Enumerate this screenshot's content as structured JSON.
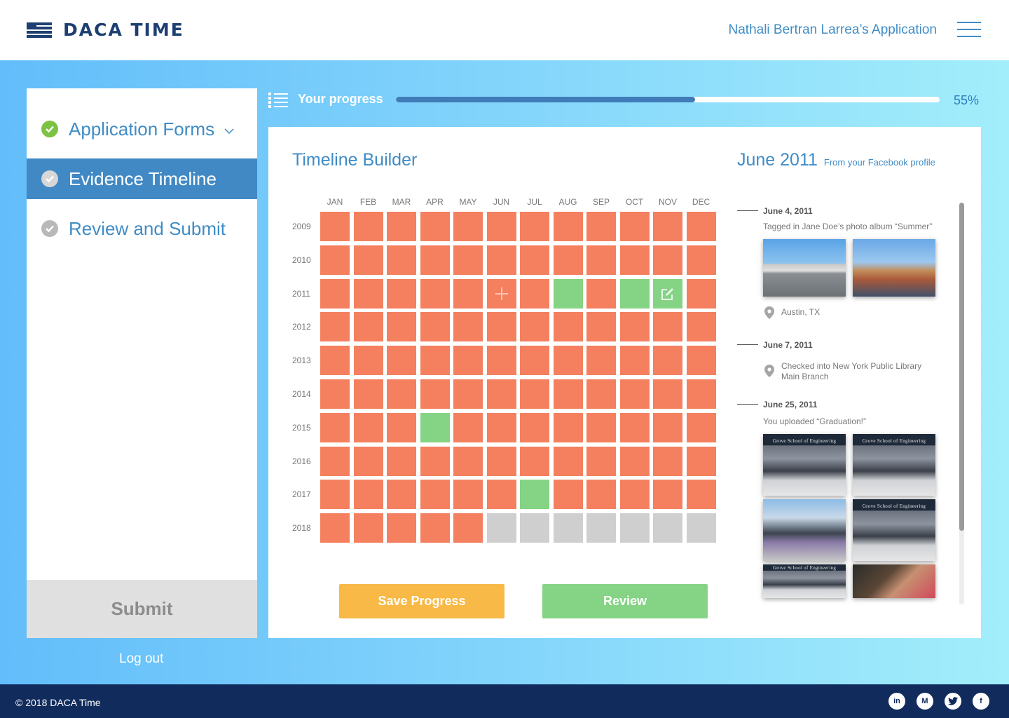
{
  "header": {
    "logo_text": "DACA TIME",
    "user_application": "Nathali Bertran Larrea’s Application"
  },
  "sidebar": {
    "items": [
      {
        "label": "Application Forms",
        "status": "complete",
        "active": false
      },
      {
        "label": "Evidence Timeline",
        "status": "pending",
        "active": true
      },
      {
        "label": "Review and Submit",
        "status": "pending",
        "active": false
      }
    ],
    "submit_label": "Submit",
    "logout_label": "Log out"
  },
  "progress": {
    "label": "Your progress",
    "value": 0.55,
    "value_text": "55%"
  },
  "timeline": {
    "title": "Timeline Builder",
    "months": [
      "JAN",
      "FEB",
      "MAR",
      "APR",
      "MAY",
      "JUN",
      "JUL",
      "AUG",
      "SEP",
      "OCT",
      "NOV",
      "DEC"
    ],
    "years": [
      "2009",
      "2010",
      "2011",
      "2012",
      "2013",
      "2014",
      "2015",
      "2016",
      "2017",
      "2018"
    ],
    "status_legend": {
      "m": "missing",
      "g": "complete",
      "x": "future"
    },
    "cells": [
      "mmmmmmmmmmmm",
      "mmmmmmmmmmmm",
      "mmmmmmmgmggm",
      "mmmmmmmmmmmm",
      "mmmmmmmmmmmm",
      "mmmmmmmmmmmm",
      "mmmgmmmmmmmm",
      "mmmmmmmmmmmm",
      "mmmmmmgmmmmm",
      "mmmmmxxxxxxx"
    ],
    "cell_icons": [
      {
        "year": "2011",
        "month": "JUN",
        "icon": "plus-icon"
      },
      {
        "year": "2011",
        "month": "NOV",
        "icon": "edit-icon"
      }
    ],
    "colors": {
      "missing": "#f4805f",
      "complete": "#85d384",
      "future": "#cfcfcf"
    }
  },
  "buttons": {
    "save": "Save Progress",
    "review": "Review"
  },
  "detail": {
    "title": "June 2011",
    "subtitle": "From your Facebook profile",
    "events": [
      {
        "date": "June 4, 2011",
        "text": "Tagged in Jane Doe’s photo album “Summer”",
        "location": "Austin, TX"
      },
      {
        "date": "June 7, 2011",
        "location_line1": "Checked into New York Public Library",
        "location_line2": "Main Branch"
      },
      {
        "date": "June 25, 2011",
        "text": "You uploaded “Graduation!”",
        "photo_sign": "Grove School of Engineering"
      }
    ]
  },
  "footer": {
    "copyright": "© 2018 DACA Time",
    "social": [
      "linkedin-icon",
      "medium-icon",
      "twitter-icon",
      "facebook-icon"
    ]
  }
}
